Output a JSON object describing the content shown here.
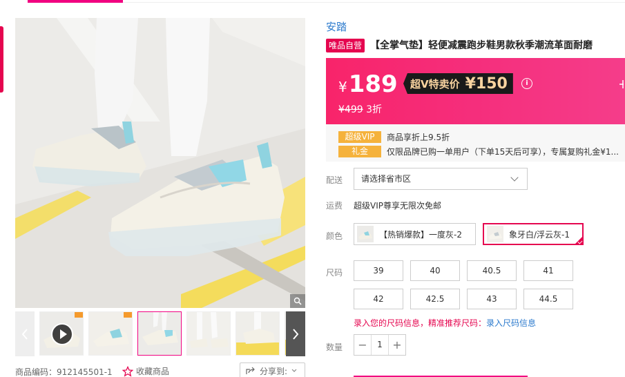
{
  "brand": "安踏",
  "vip_tag": "唯品自营",
  "title": "【全掌气垫】轻便减震跑步鞋男款秋季潮流革面耐磨",
  "price": {
    "currency": "¥",
    "current": "189",
    "svip_label": "超V特卖价",
    "svip_price": "¥150",
    "info_icon": "i",
    "original": "¥499",
    "discount": "3折"
  },
  "perks": [
    {
      "tag": "超级VIP",
      "text": "商品享折上9.5折"
    },
    {
      "tag": "礼金",
      "text": "仅限品牌已购一单用户（下单15天后可享），专属复购礼金¥1..."
    }
  ],
  "delivery": {
    "label": "配送",
    "placeholder": "请选择省市区"
  },
  "freight": {
    "label": "运费",
    "text": "超级VIP尊享无限次免邮"
  },
  "color": {
    "label": "颜色",
    "options": [
      {
        "name": "【热销爆款】一度灰-2",
        "selected": false
      },
      {
        "name": "象牙白/浮云灰-1",
        "selected": true
      }
    ]
  },
  "size": {
    "label": "尺码",
    "options": [
      "39",
      "40",
      "40.5",
      "41",
      "42",
      "42.5",
      "43",
      "44.5"
    ],
    "info_text": "录入您的尺码信息，精准推荐尺码：",
    "info_link": "录入尺码信息"
  },
  "quantity": {
    "label": "数量",
    "value": "1",
    "minus": "−",
    "plus": "+"
  },
  "meta": {
    "product_code": "商品编码：912145501-1",
    "favorite": "收藏商品",
    "share": "分享到:"
  },
  "colors": {
    "accent": "#f10180",
    "vip_red": "#e5054f",
    "link": "#2b7acd",
    "perk_tag": "#f5b23c"
  }
}
